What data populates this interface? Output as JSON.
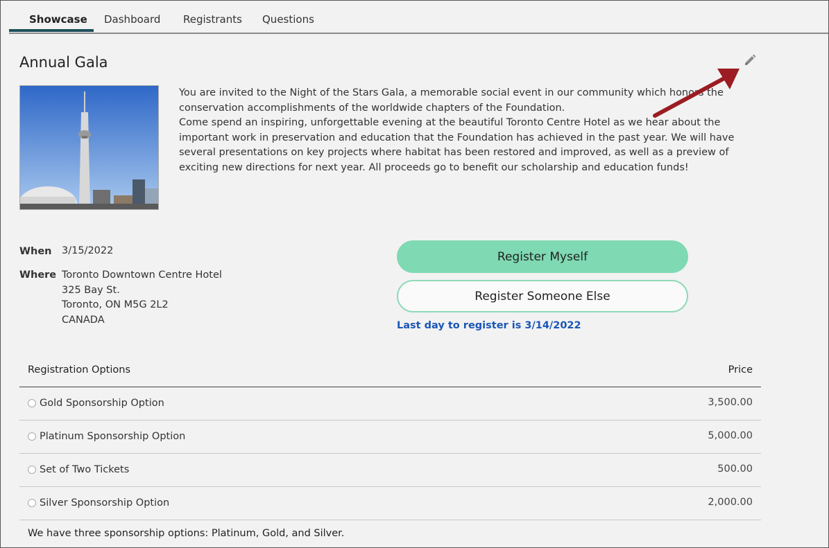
{
  "tabs": [
    {
      "label": "Showcase",
      "active": true
    },
    {
      "label": "Dashboard",
      "active": false
    },
    {
      "label": "Registrants",
      "active": false
    },
    {
      "label": "Questions",
      "active": false
    }
  ],
  "event": {
    "title": "Annual Gala",
    "description_1": "You are invited to the Night of the Stars Gala, a memorable social event in our community which honors the conservation accomplishments of the worldwide chapters of the Foundation.",
    "description_2": "Come spend an inspiring, unforgettable evening at the beautiful Toronto Centre Hotel as we hear about the important work in preservation and education that the Foundation has achieved in the past year. We will have several presentations on key projects where habitat has been restored and improved, as well as a preview  of exciting new directions for next year. All proceeds go to benefit our scholarship and education funds!",
    "when_label": "When",
    "when_value": "3/15/2022",
    "where_label": "Where",
    "where_lines": [
      "Toronto Downtown Centre Hotel",
      "325 Bay St.",
      "Toronto, ON M5G 2L2",
      "CANADA"
    ]
  },
  "actions": {
    "register_myself": "Register Myself",
    "register_someone_else": "Register Someone Else",
    "last_day": "Last day to register is 3/14/2022"
  },
  "registration": {
    "header_options": "Registration Options",
    "header_price": "Price",
    "rows": [
      {
        "option": "Gold Sponsorship Option",
        "price": "3,500.00"
      },
      {
        "option": "Platinum Sponsorship Option",
        "price": "5,000.00"
      },
      {
        "option": "Set of Two Tickets",
        "price": "500.00"
      },
      {
        "option": "Silver Sponsorship Option",
        "price": "2,000.00"
      }
    ],
    "note": "We have three sponsorship options: Platinum, Gold, and Silver."
  },
  "icons": {
    "edit": "pencil-icon",
    "annotation": "arrow-icon"
  },
  "colors": {
    "primary_button": "#7fd9b2",
    "link_blue": "#1a56b5",
    "tab_underline": "#1f4f5a",
    "arrow": "#9b1c22"
  }
}
